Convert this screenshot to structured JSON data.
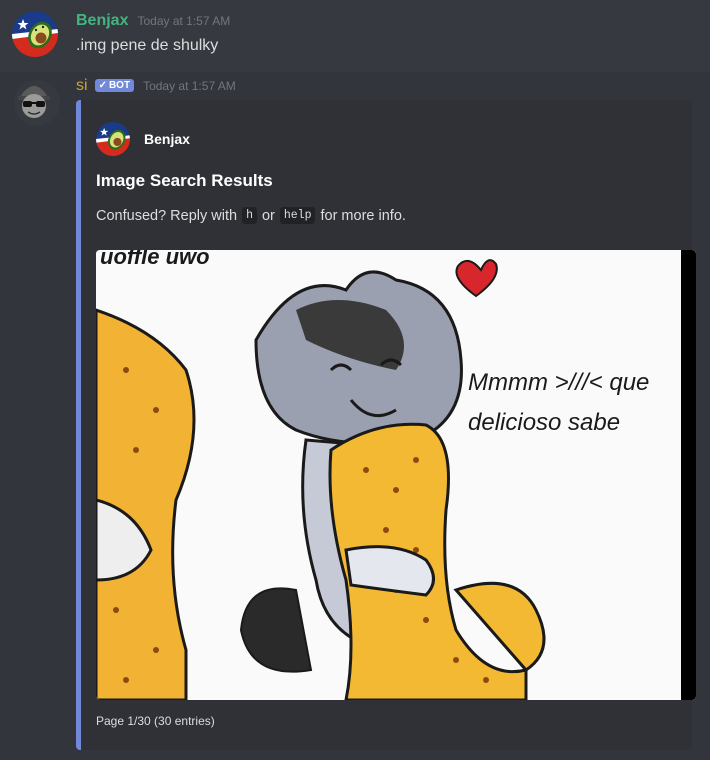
{
  "messages": [
    {
      "username": "Benjax",
      "timestamp": "Today at 1:57 AM",
      "content": ".img pene de shulky"
    },
    {
      "username": "si",
      "bot_tag": "BOT",
      "timestamp": "Today at 1:57 AM",
      "embed": {
        "author": "Benjax",
        "title": "Image Search Results",
        "description_prefix": "Confused? Reply with",
        "code1": "h",
        "description_or": "or",
        "code2": "help",
        "description_suffix": "for more info.",
        "image_text_line1": "Mmmm >///< que",
        "image_text_line2": "delicioso sabe",
        "image_text_top": "uoffle uwo",
        "footer": "Page 1/30 (30 entries)"
      }
    }
  ],
  "colors": {
    "username_benjax": "#43b581",
    "username_si": "#c9a43a",
    "embed_accent": "#7289da",
    "bot_tag": "#7289da"
  },
  "icons": {
    "benjax_avatar": "avocado-avatar-icon",
    "si_avatar": "sunglasses-bot-avatar-icon",
    "verified": "check-icon"
  }
}
